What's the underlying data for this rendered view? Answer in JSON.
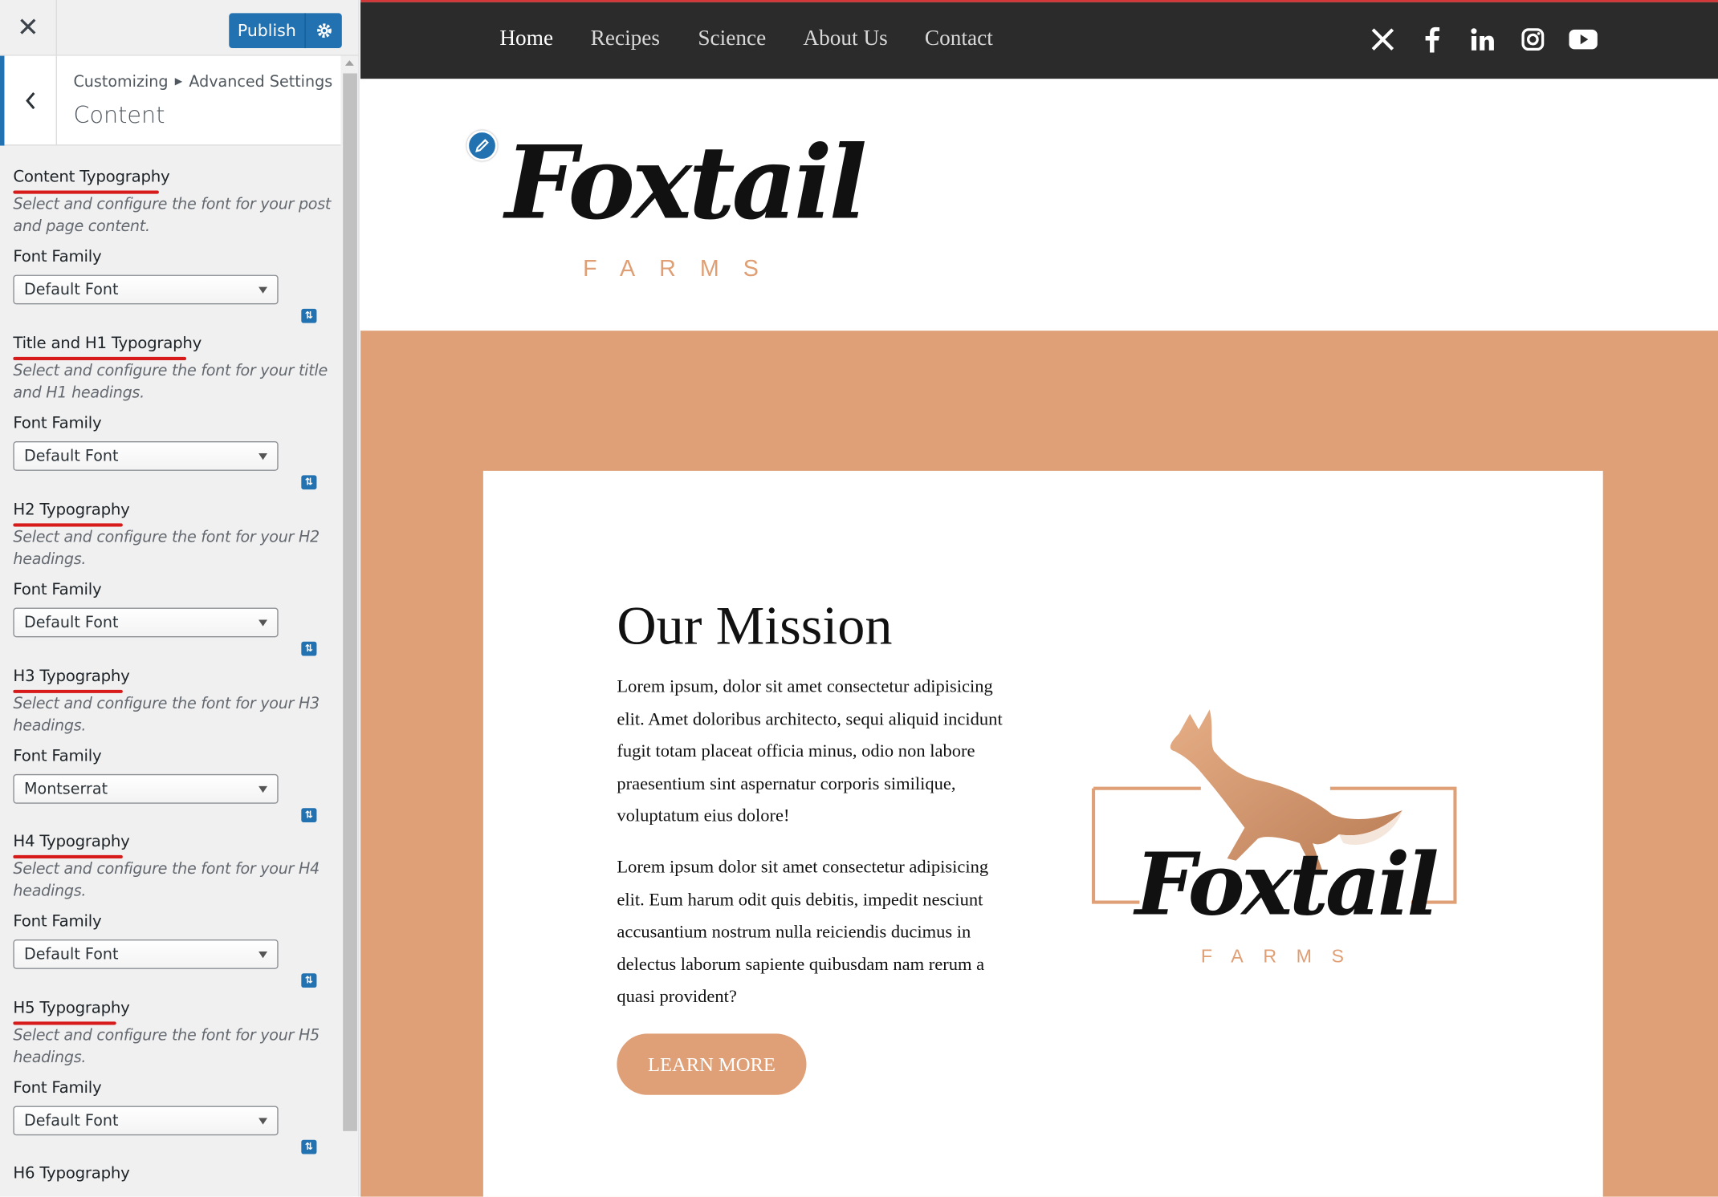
{
  "panel": {
    "close_label": "✕",
    "publish_label": "Publish",
    "breadcrumb": [
      "Customizing",
      "Advanced Settings"
    ],
    "section_title": "Content",
    "controls": [
      {
        "title": "Content Typography",
        "desc": "Select and configure the font for your post and page content.",
        "ff_label": "Font Family",
        "value": "Default Font",
        "underlined": true
      },
      {
        "title": "Title and H1 Typography",
        "desc": "Select and configure the font for your title and H1 headings.",
        "ff_label": "Font Family",
        "value": "Default Font",
        "underlined": true
      },
      {
        "title": "H2 Typography",
        "desc": "Select and configure the font for your H2 headings.",
        "ff_label": "Font Family",
        "value": "Default Font",
        "underlined": true
      },
      {
        "title": "H3 Typography",
        "desc": "Select and configure the font for your H3 headings.",
        "ff_label": "Font Family",
        "value": "Montserrat",
        "underlined": true
      },
      {
        "title": "H4 Typography",
        "desc": "Select and configure the font for your H4 headings.",
        "ff_label": "Font Family",
        "value": "Default Font",
        "underlined": true
      },
      {
        "title": "H5 Typography",
        "desc": "Select and configure the font for your H5 headings.",
        "ff_label": "Font Family",
        "value": "Default Font",
        "underlined": true
      },
      {
        "title": "H6 Typography",
        "underlined": false
      }
    ]
  },
  "site": {
    "nav": [
      "Home",
      "Recipes",
      "Science",
      "About Us",
      "Contact"
    ],
    "active_nav": "Home",
    "social_icons": [
      "x-icon",
      "facebook-icon",
      "linkedin-icon",
      "instagram-icon",
      "youtube-icon"
    ],
    "logo_word": "Foxtail",
    "logo_sub": "FARMS",
    "mission_title": "Our Mission",
    "para1": "Lorem ipsum, dolor sit amet consectetur adipisicing elit. Amet doloribus architecto, sequi aliquid incidunt fugit totam placeat officia minus, odio non labore praesentium sint aspernatur corporis similique, voluptatum eius dolore!",
    "para2": "Lorem ipsum dolor sit amet consectetur adipisicing elit. Eum harum odit quis debitis, impedit nesciunt accusantium nostrum nulla reiciendis ducimus in delectus laborum sapiente quibusdam nam rerum a quasi provident?",
    "button": "LEARN MORE"
  },
  "colors": {
    "accent": "#dfa077",
    "wp_blue": "#2271b1",
    "nav_bg": "#2b2b2b",
    "underline_red": "#d71a1a"
  }
}
